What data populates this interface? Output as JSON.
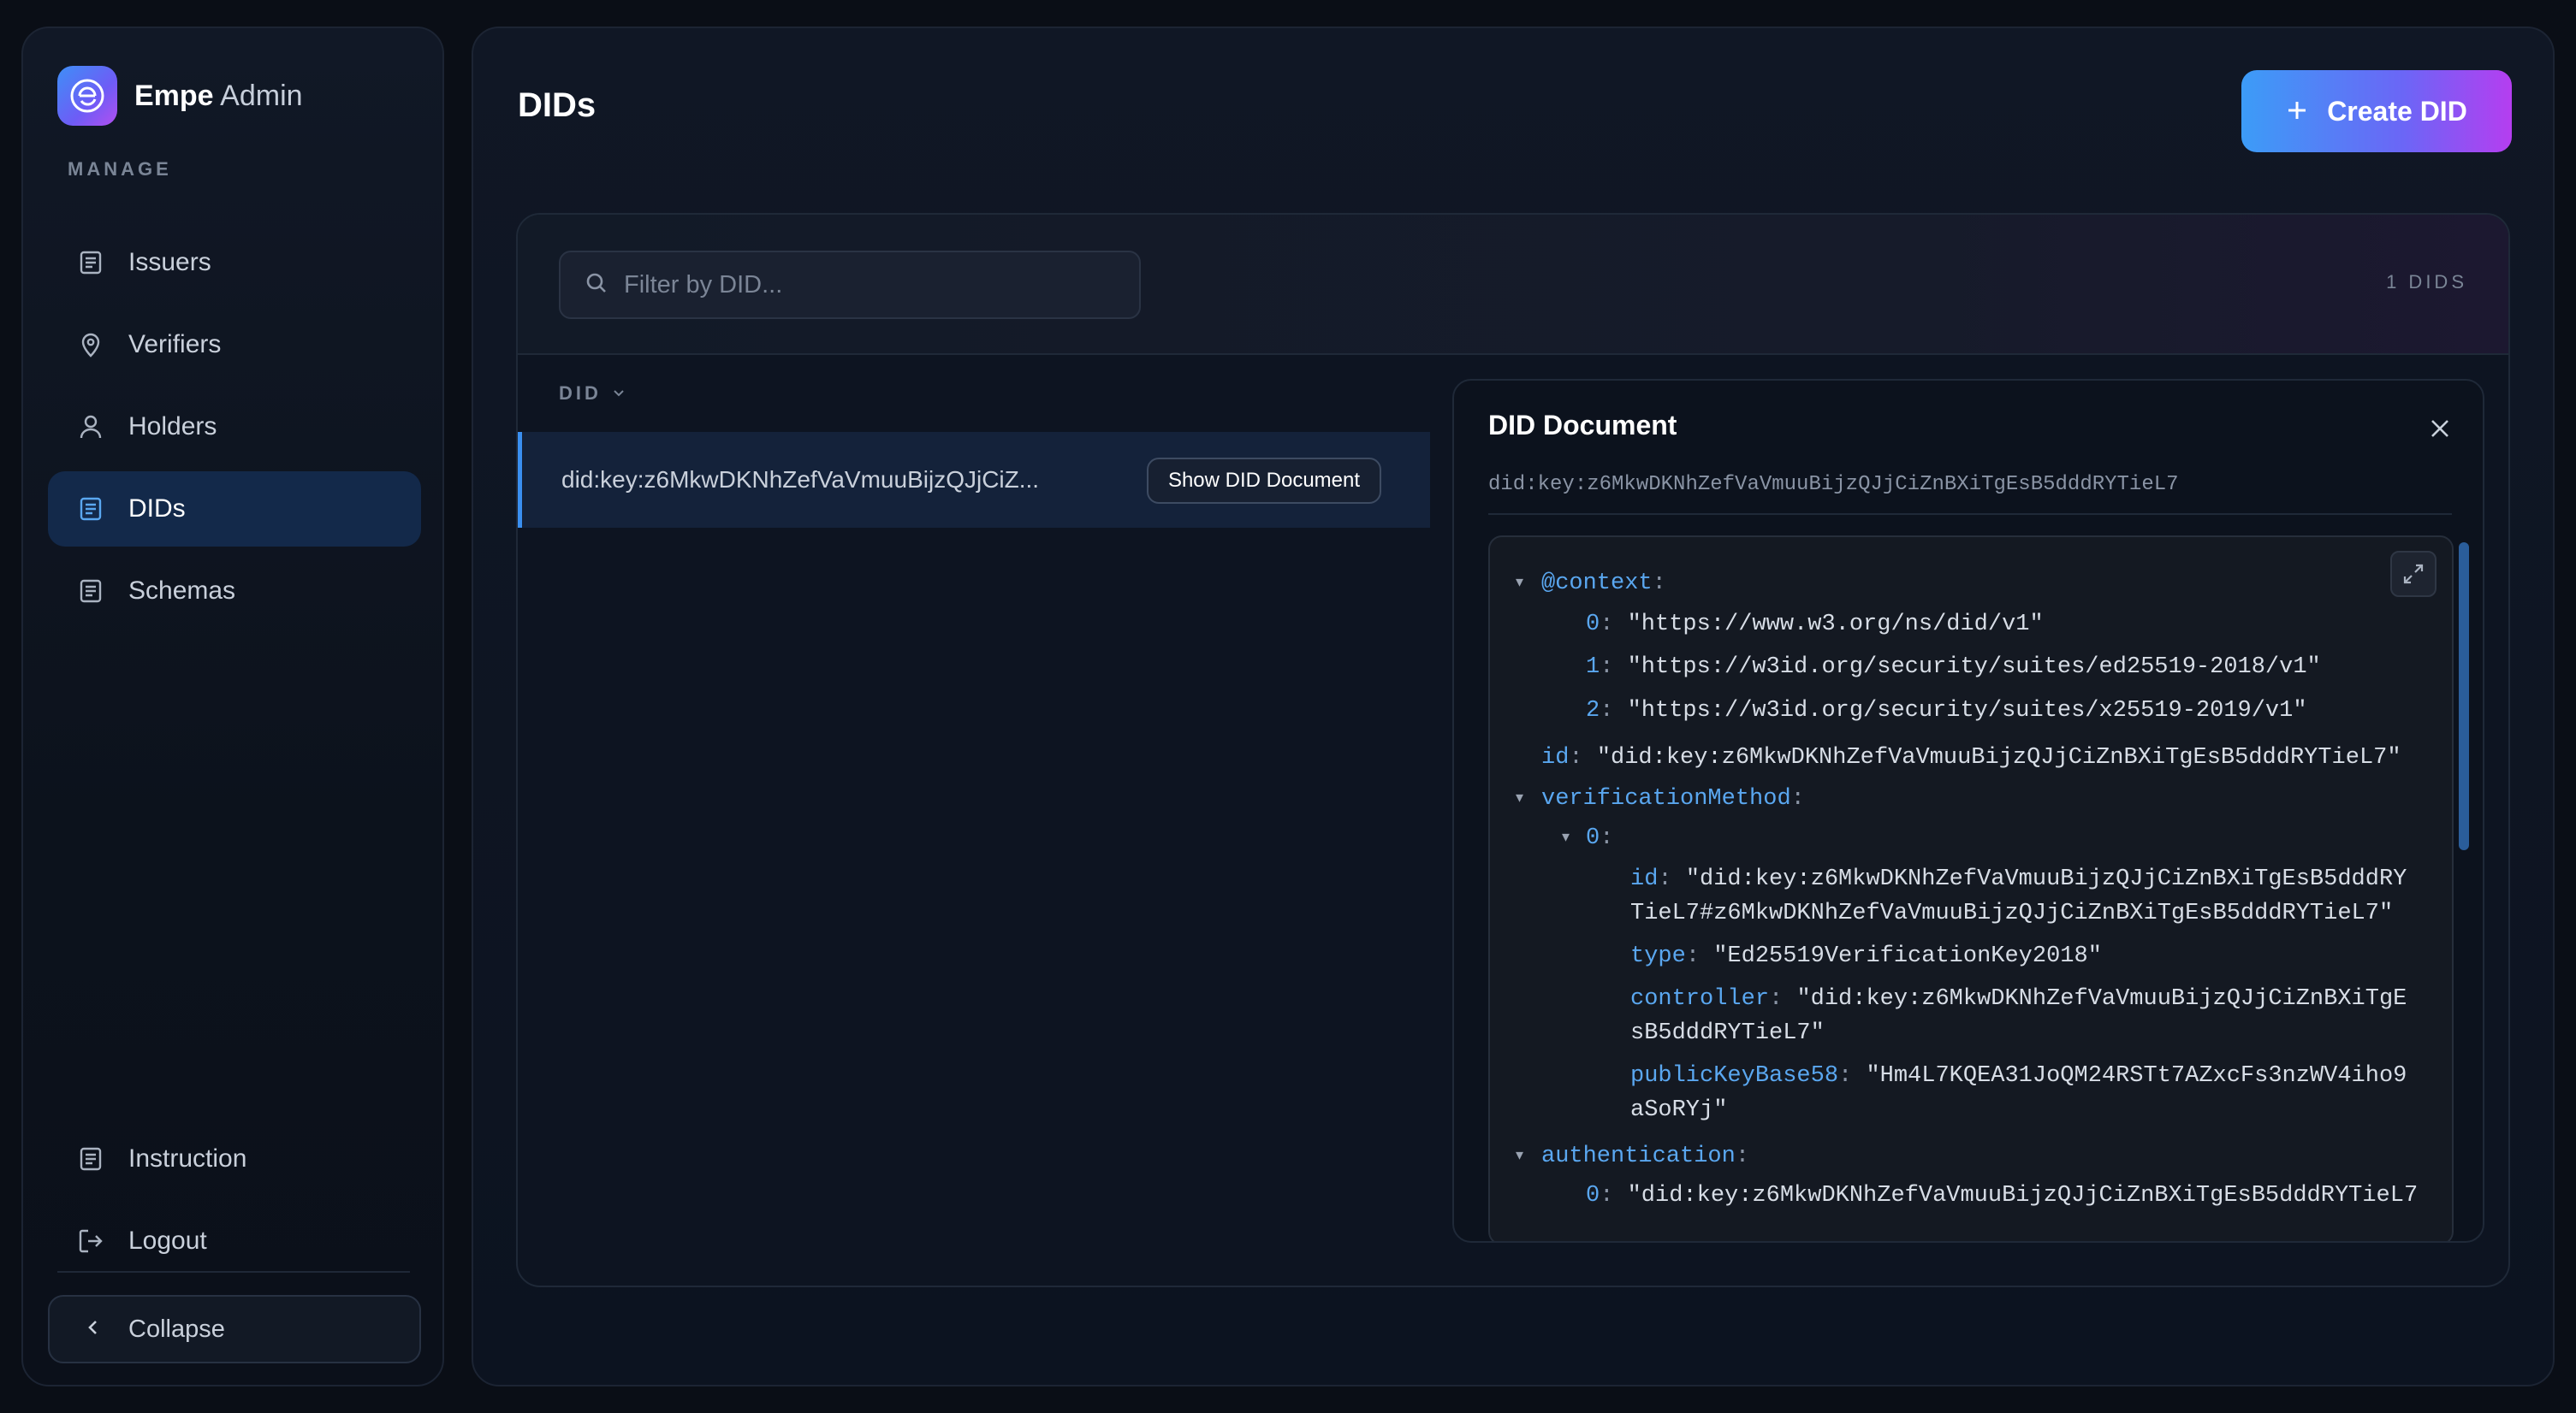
{
  "brand": {
    "name_bold": "Empe",
    "name_light": "Admin"
  },
  "sidebar": {
    "section_label": "MANAGE",
    "items": [
      {
        "label": "Issuers",
        "icon": "document-list-icon"
      },
      {
        "label": "Verifiers",
        "icon": "location-pin-icon"
      },
      {
        "label": "Holders",
        "icon": "user-icon"
      },
      {
        "label": "DIDs",
        "icon": "document-list-icon",
        "active": true
      },
      {
        "label": "Schemas",
        "icon": "document-list-icon"
      }
    ],
    "bottom_items": [
      {
        "label": "Instruction",
        "icon": "document-list-icon"
      },
      {
        "label": "Logout",
        "icon": "logout-icon"
      }
    ],
    "collapse_label": "Collapse"
  },
  "page": {
    "title": "DIDs",
    "create_label": "Create DID"
  },
  "table": {
    "search_placeholder": "Filter by DID...",
    "count": "1 DIDS",
    "column_header": "DID",
    "rows": [
      {
        "did": "did:key:z6MkwDKNhZefVaVmuuBijzQJjCiZ...",
        "action_label": "Show DID Document"
      }
    ]
  },
  "doc": {
    "title": "DID Document",
    "subtitle": "did:key:z6MkwDKNhZefVaVmuuBijzQJjCiZnBXiTgEsB5dddRYTieL7",
    "lines": {
      "ctx_key": "@context",
      "ctx0_idx": "0",
      "ctx0_val": "\"https://www.w3.org/ns/did/v1\"",
      "ctx1_idx": "1",
      "ctx1_val": "\"https://w3id.org/security/suites/ed25519-2018/v1\"",
      "ctx2_idx": "2",
      "ctx2_val": "\"https://w3id.org/security/suites/x25519-2019/v1\"",
      "id_key": "id",
      "id_val": "\"did:key:z6MkwDKNhZefVaVmuuBijzQJjCiZnBXiTgEsB5dddRYTieL7\"",
      "vm_key": "verificationMethod",
      "vm0_idx": "0",
      "vm_id_key": "id",
      "vm_id_val1": "\"did:key:z6MkwDKNhZefVaVmuuBijzQJjCiZnBXiTgEsB5dddRY",
      "vm_id_val2": "TieL7#z6MkwDKNhZefVaVmuuBijzQJjCiZnBXiTgEsB5dddRYTieL7\"",
      "vm_type_key": "type",
      "vm_type_val": "\"Ed25519VerificationKey2018\"",
      "vm_ctrl_key": "controller",
      "vm_ctrl_val1": "\"did:key:z6MkwDKNhZefVaVmuuBijzQJjCiZnBXiTgE",
      "vm_ctrl_val2": "sB5dddRYTieL7\"",
      "vm_pk_key": "publicKeyBase58",
      "vm_pk_val1": "\"Hm4L7KQEA31JoQM24RSTt7AZxcFs3nzWV4iho9",
      "vm_pk_val2": "aSoRYj\"",
      "auth_key": "authentication",
      "auth0_idx": "0",
      "auth0_val": "\"did:key:z6MkwDKNhZefVaVmuuBijzQJjCiZnBXiTgEsB5dddRYTieL7"
    }
  },
  "colors": {
    "accent_start": "#3c9cf7",
    "accent_end": "#b53ef0",
    "active_nav": "#13294a",
    "json_key": "#5aa7f0"
  }
}
